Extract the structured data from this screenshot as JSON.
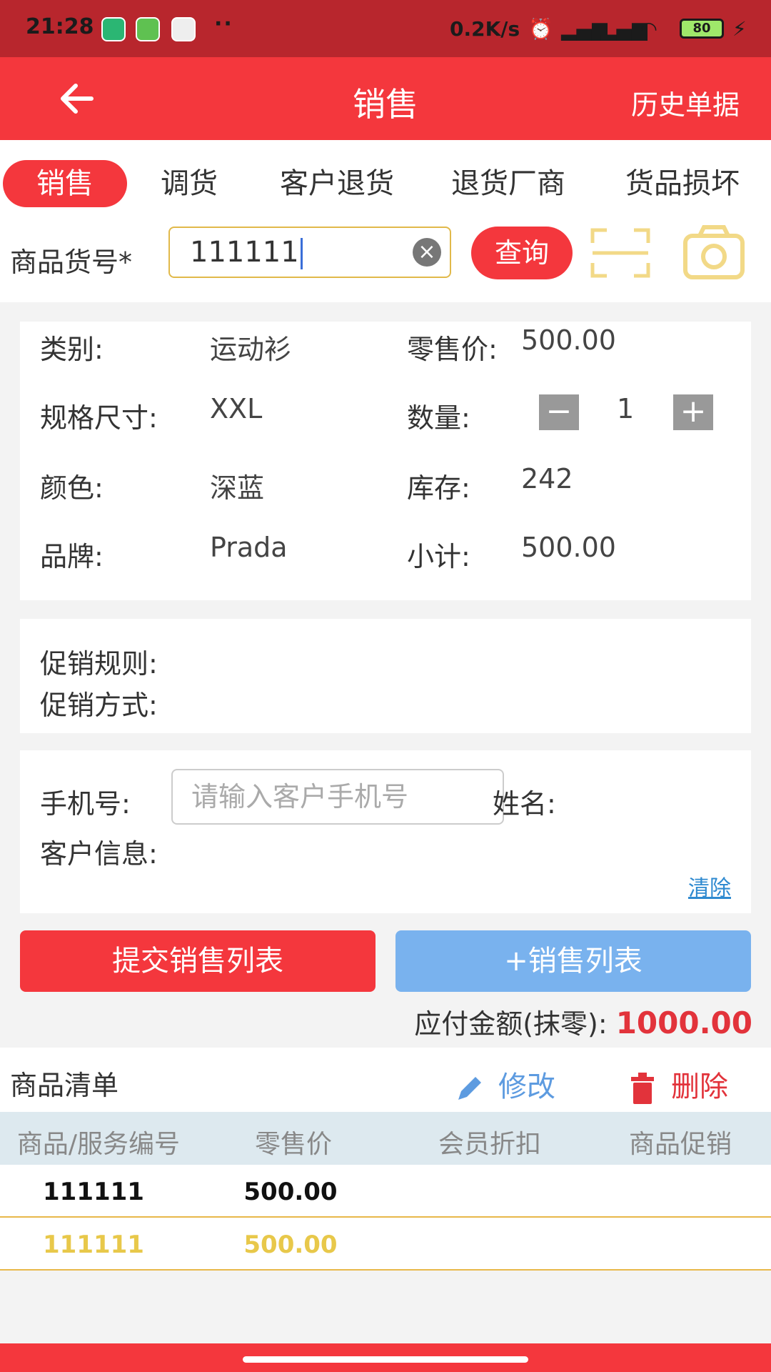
{
  "status_bar": {
    "time": "21:28",
    "dots": "··",
    "net_speed": "0.2K/s",
    "battery": "80"
  },
  "header": {
    "title": "销售",
    "history": "历史单据"
  },
  "tabs": [
    {
      "label": "销售"
    },
    {
      "label": "调货"
    },
    {
      "label": "客户退货"
    },
    {
      "label": "退货厂商"
    },
    {
      "label": "货品损坏"
    }
  ],
  "search": {
    "label": "商品货号*",
    "value": "111111",
    "query_button": "查询"
  },
  "product": {
    "category_label": "类别:",
    "category": "运动衫",
    "size_label": "规格尺寸:",
    "size": "XXL",
    "color_label": "颜色:",
    "color": "深蓝",
    "brand_label": "品牌:",
    "brand": "Prada",
    "price_label": "零售价:",
    "price": "500.00",
    "qty_label": "数量:",
    "qty": "1",
    "stock_label": "库存:",
    "stock": "242",
    "subtotal_label": "小计:",
    "subtotal": "500.00"
  },
  "promo": {
    "rule_label": "促销规则:",
    "method_label": "促销方式:"
  },
  "customer": {
    "phone_label": "手机号:",
    "phone_placeholder": "请输入客户手机号",
    "name_label": "姓名:",
    "info_label": "客户信息:",
    "clear": "清除"
  },
  "actions": {
    "submit": "提交销售列表",
    "add": "+销售列表"
  },
  "payable": {
    "label": "应付金额(抹零):",
    "amount": "1000.00"
  },
  "goods_list": {
    "title": "商品清单",
    "edit": "修改",
    "delete": "删除",
    "columns": [
      "商品/服务编号",
      "零售价",
      "会员折扣",
      "商品促销"
    ],
    "rows": [
      {
        "code": "111111",
        "price": "500.00"
      },
      {
        "code": "111111",
        "price": "500.00"
      }
    ]
  },
  "colors": {
    "primary": "#f4373d",
    "status_bar": "#b8262d",
    "accent_blue": "#79b2ee",
    "highlight": "#e8c84a"
  }
}
